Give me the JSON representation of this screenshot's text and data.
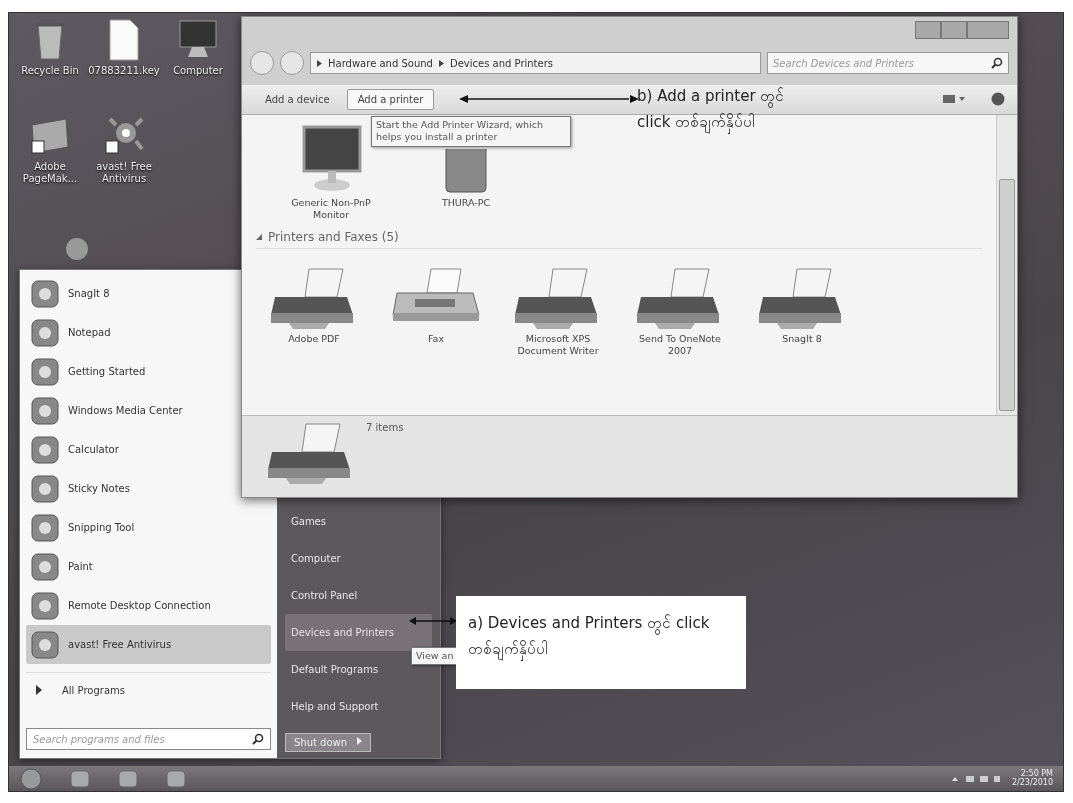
{
  "desktop_icons": [
    {
      "label": "Recycle Bin"
    },
    {
      "label": "07883211.key"
    },
    {
      "label": "Computer"
    },
    {
      "label": "Adobe PageMak..."
    },
    {
      "label": "avast! Free Antivirus"
    }
  ],
  "explorer": {
    "breadcrumb": [
      "Hardware and Sound",
      "Devices and Printers"
    ],
    "search": {
      "placeholder": "Search Devices and Printers"
    },
    "toolbar": [
      {
        "label": "Add a device",
        "selected": false
      },
      {
        "label": "Add a printer",
        "selected": true
      }
    ],
    "tooltip": "Start the Add Printer Wizard, which helps you install a printer",
    "devices": [
      {
        "label": "Generic Non-PnP Monitor"
      },
      {
        "label": "THURA-PC"
      }
    ],
    "group": "Printers and Faxes (5)",
    "printers": [
      {
        "label": "Adobe PDF"
      },
      {
        "label": "Fax"
      },
      {
        "label": "Microsoft XPS Document Writer"
      },
      {
        "label": "Send To OneNote 2007"
      },
      {
        "label": "SnagIt 8"
      }
    ],
    "status": "7 items"
  },
  "start_menu": {
    "programs": [
      {
        "label": "SnagIt 8",
        "selected": false
      },
      {
        "label": "Notepad",
        "selected": false
      },
      {
        "label": "Getting Started",
        "selected": false
      },
      {
        "label": "Windows Media Center",
        "selected": false
      },
      {
        "label": "Calculator",
        "selected": false
      },
      {
        "label": "Sticky Notes",
        "selected": false
      },
      {
        "label": "Snipping Tool",
        "selected": false
      },
      {
        "label": "Paint",
        "selected": false
      },
      {
        "label": "Remote Desktop Connection",
        "selected": false
      },
      {
        "label": "avast! Free Antivirus",
        "selected": true
      }
    ],
    "all_programs": "All Programs",
    "search": {
      "placeholder": "Search programs and files"
    },
    "places": [
      {
        "label": "Games",
        "selected": false
      },
      {
        "label": "Computer",
        "selected": false
      },
      {
        "label": "Control Panel",
        "selected": false
      },
      {
        "label": "Devices and Printers",
        "selected": true
      },
      {
        "label": "Default Programs",
        "selected": false
      },
      {
        "label": "Help and Support",
        "selected": false
      }
    ],
    "shutdown": "Shut down",
    "tooltip": "View an"
  },
  "annotations": [
    {
      "text": "b) Add a printer တွင် click တစ်ချက်နှိပ်ပါ"
    },
    {
      "text": "a) Devices and Printers တွင် click တစ်ချက်နှိပ်ပါ"
    }
  ],
  "taskbar": {
    "time": "2:50 PM",
    "date": "2/23/2010"
  }
}
